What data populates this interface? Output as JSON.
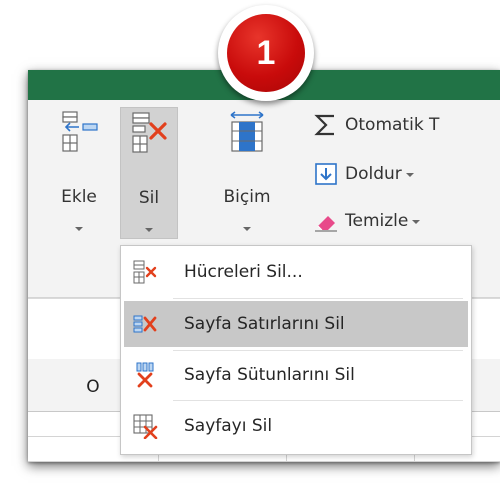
{
  "badge": {
    "number": "1"
  },
  "ribbon": {
    "insert_label": "Ekle",
    "delete_label": "Sil",
    "format_label": "Biçim",
    "autosum_label": "Otomatik T",
    "fill_label": "Doldur",
    "clear_label": "Temizle"
  },
  "columns": {
    "visible_label": "O"
  },
  "menu": {
    "items": [
      {
        "label": "Hücreleri Sil...",
        "icon": "delete-cells-icon"
      },
      {
        "label": "Sayfa Satırlarını Sil",
        "icon": "delete-rows-icon"
      },
      {
        "label": "Sayfa Sütunlarını Sil",
        "icon": "delete-columns-icon"
      },
      {
        "label": "Sayfayı Sil",
        "icon": "delete-sheet-icon"
      }
    ],
    "highlighted_index": 1
  },
  "colors": {
    "ribbon_green": "#217346",
    "delete_red": "#e2401d",
    "badge_red": "#c90b0b",
    "accent_blue": "#2e74c9"
  }
}
